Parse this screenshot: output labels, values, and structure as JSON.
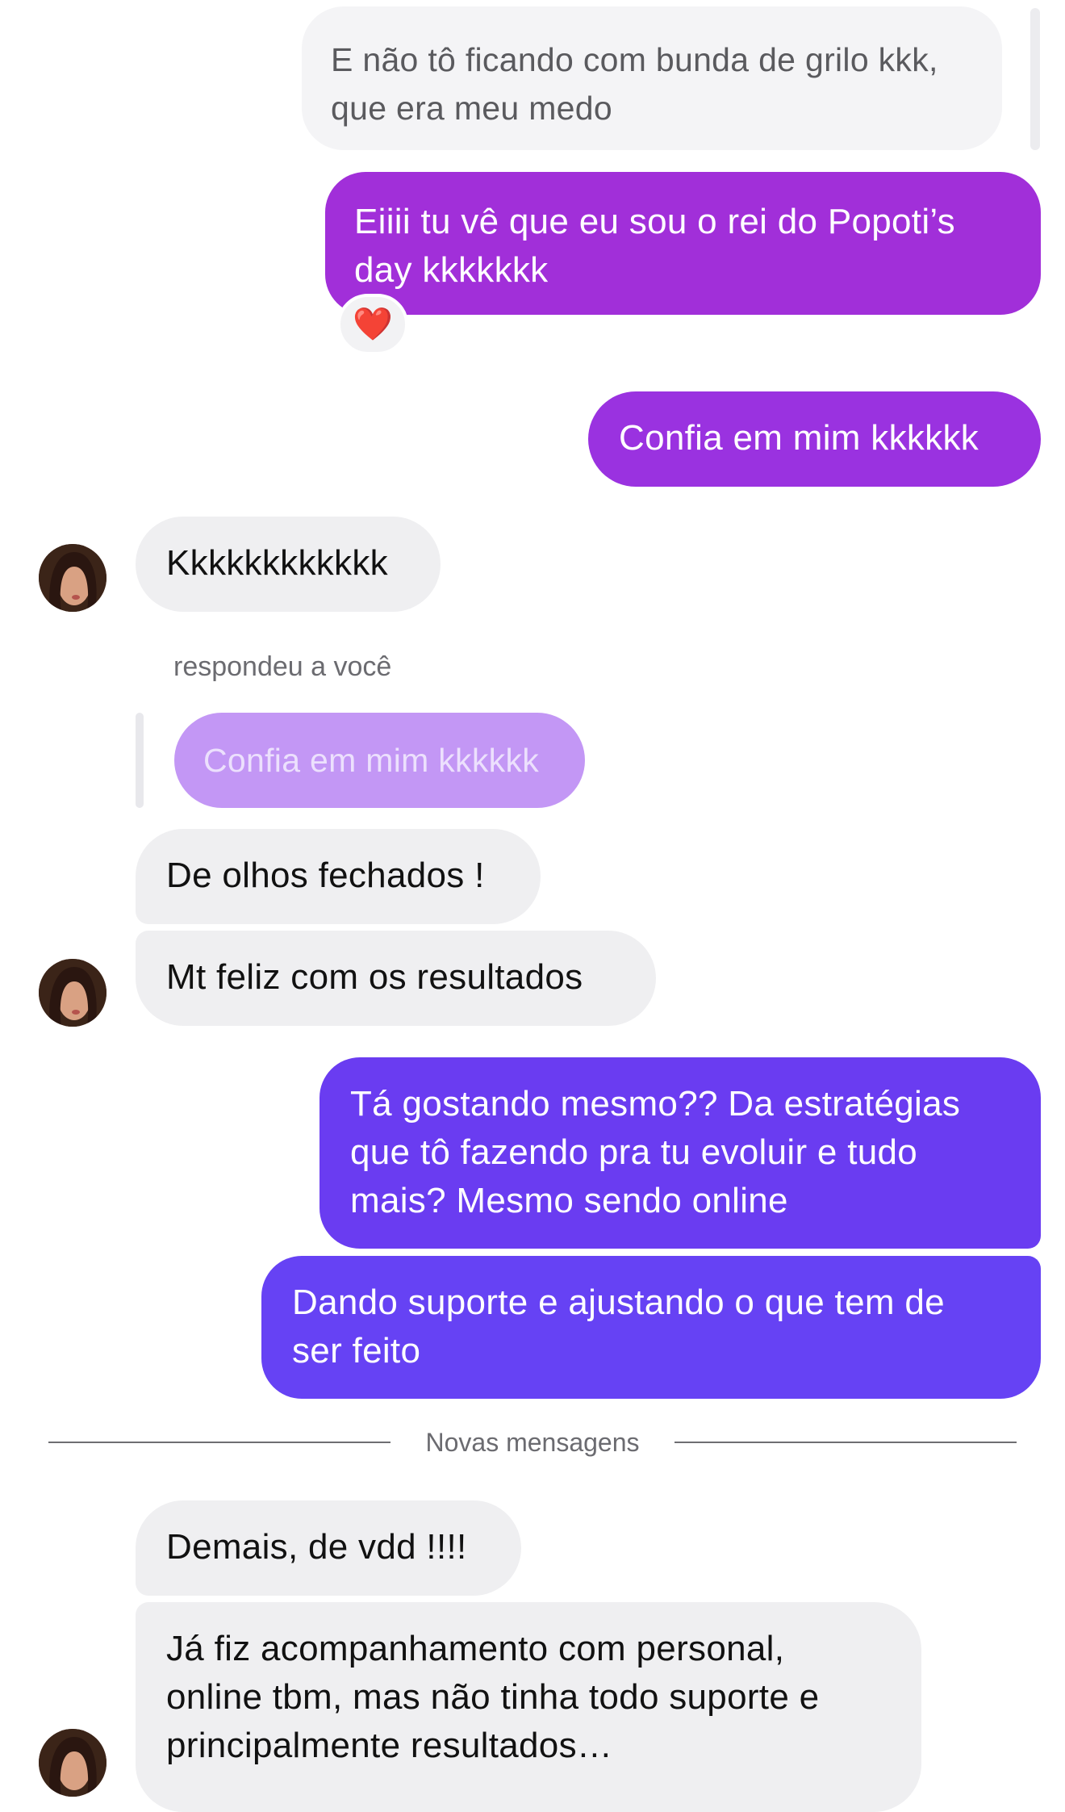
{
  "messages": {
    "m1": "E não tô ficando com bunda de grilo kkk,\nque era meu medo",
    "m2": "Eiiii tu vê que eu sou o rei do Popoti’s\nday kkkkkkk",
    "m3": "Confia em mim kkkkkk",
    "m4": "Kkkkkkkkkkkk",
    "m5": "De olhos fechados !",
    "m6": "Mt feliz com os resultados",
    "m7": "Tá gostando mesmo?? Da estratégias\nque tô fazendo pra tu evoluir e tudo\nmais? Mesmo sendo online",
    "m8": "Dando suporte e ajustando o que tem de\nser feito",
    "m9": "Demais, de vdd !!!!",
    "m10": "Já fiz acompanhamento com personal,\nonline tbm, mas não tinha todo suporte e\nprincipalmente resultados…"
  },
  "reply": {
    "label": "respondeu a você",
    "quoted_text": "Confia em mim kkkkkk"
  },
  "reaction": {
    "emoji": "❤️",
    "icon": "heart-icon"
  },
  "divider": {
    "label": "Novas mensagens"
  },
  "colors": {
    "incoming_bg": "#efeff1",
    "outgoing_gradient": [
      "#a52fd6",
      "#6a3ff3"
    ],
    "quoted_bg": "#c397f5"
  }
}
